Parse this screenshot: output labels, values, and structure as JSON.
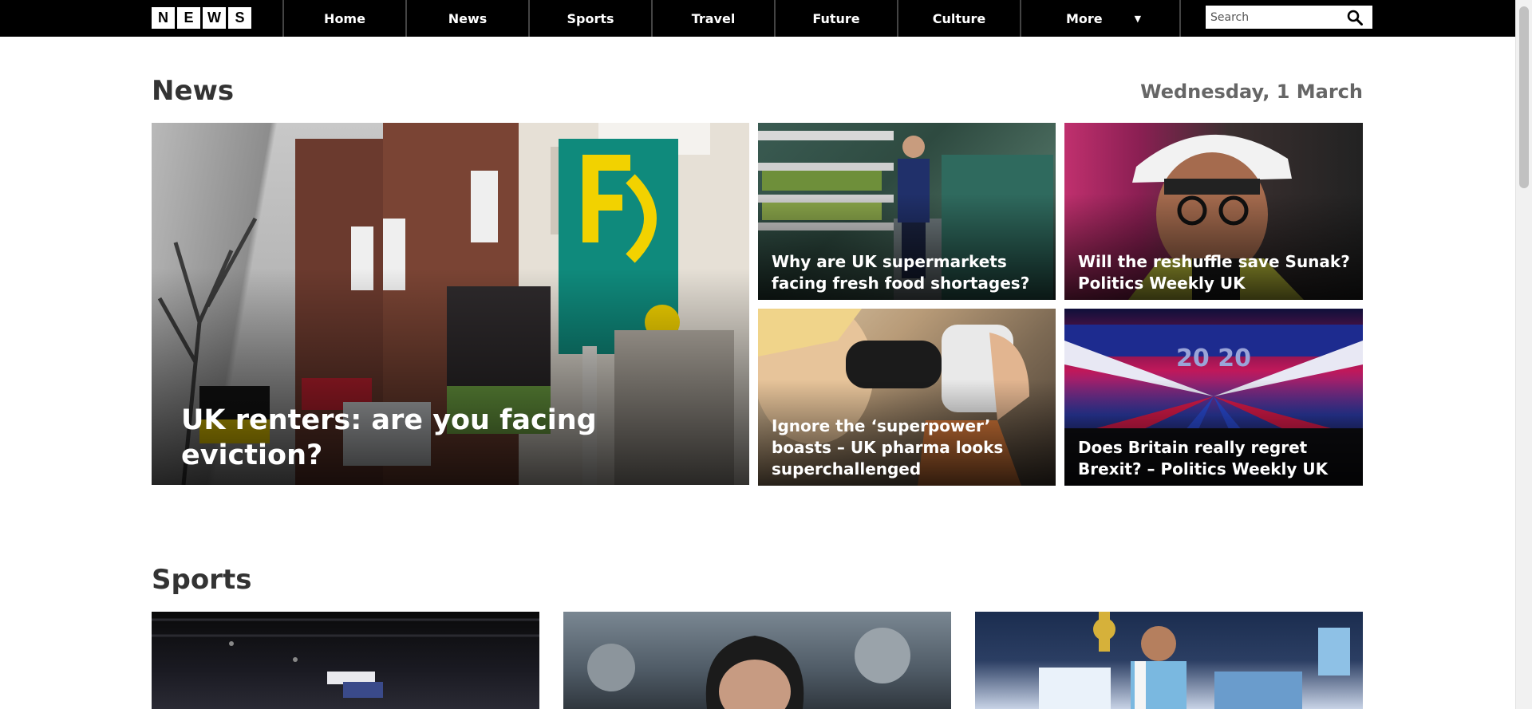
{
  "header": {
    "logo_letters": [
      "N",
      "E",
      "W",
      "S"
    ],
    "nav": [
      {
        "label": "Home"
      },
      {
        "label": "News"
      },
      {
        "label": "Sports"
      },
      {
        "label": "Travel"
      },
      {
        "label": "Future"
      },
      {
        "label": "Culture"
      },
      {
        "label": "More"
      }
    ],
    "search_placeholder": "Search",
    "icons": {
      "search": "search-icon",
      "more": "caret-down-icon"
    }
  },
  "news": {
    "title": "News",
    "date": "Wednesday, 1 March",
    "feature": {
      "headline": "UK renters: are you facing eviction?"
    },
    "stories": [
      {
        "headline": "Why are UK supermarkets facing fresh food shortages?"
      },
      {
        "headline": "Will the reshuffle save Sunak? Politics Weekly UK"
      },
      {
        "headline": "Ignore the ‘superpower’ boasts – UK pharma looks superchallenged"
      },
      {
        "headline": "Does Britain really regret Brexit? – Politics Weekly UK"
      }
    ]
  },
  "sports": {
    "title": "Sports"
  },
  "colors": {
    "nav_bg": "#000000",
    "page_bg": "#ffffff",
    "heading": "#333333",
    "date": "#666666"
  }
}
